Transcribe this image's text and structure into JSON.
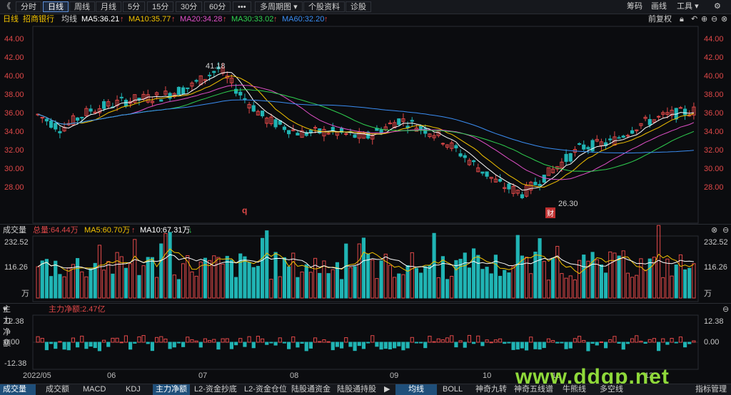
{
  "toolbar": {
    "back": "《",
    "tabs": [
      "分时",
      "日线",
      "周线",
      "月线",
      "5分",
      "15分",
      "30分",
      "60分",
      "•••",
      "多周期图",
      "个股资料",
      "诊股"
    ],
    "active_tab": "日线",
    "right": [
      "筹码",
      "画线",
      "工具",
      "⚙"
    ]
  },
  "ma_row": {
    "period": "日线",
    "stock": "招商银行",
    "indicator": "均线",
    "ma5": "MA5:36.21",
    "ma10": "MA10:35.77",
    "ma20": "MA20:34.28",
    "ma30": "MA30:33.02",
    "ma60": "MA60:32.20",
    "adjust": "前复权"
  },
  "colors": {
    "up": "#e04848",
    "down": "#20b4b4",
    "ma5": "#ffffff",
    "ma10": "#f2c200",
    "ma20": "#e050c8",
    "ma30": "#2fd050",
    "ma60": "#3a8df2"
  },
  "price_axis": [
    "44.00",
    "42.00",
    "40.00",
    "38.00",
    "36.00",
    "34.00",
    "32.00",
    "30.00",
    "28.00"
  ],
  "annotations": {
    "high": "41.18",
    "low": "26.30",
    "marker_q": "q",
    "marker_cai": "财"
  },
  "volume_panel": {
    "title": "成交量",
    "total": "总量:64.44万",
    "ma5": "MA5:60.70万",
    "ma10": "MA10:67.31万",
    "axis": [
      "232.52",
      "116.26",
      "万"
    ]
  },
  "flow_panel": {
    "title": "主力净额",
    "value": "主力净额:2.47亿",
    "axis": [
      "12.38",
      "0.00",
      "-12.38"
    ]
  },
  "dates": [
    "2022/05",
    "06",
    "07",
    "08",
    "09",
    "10",
    "11",
    "12"
  ],
  "bottom_tabs": [
    "成交量",
    "成交额",
    "MACD",
    "KDJ",
    "主力净额",
    "L2-资金抄底",
    "L2-资金仓位",
    "陆股通资金",
    "陆股通持股",
    "均线",
    "BOLL",
    "神奇九转",
    "神奇五线谱",
    "牛熊线",
    "多空线",
    "指标管理"
  ],
  "watermark": "www.ddgp.net"
}
